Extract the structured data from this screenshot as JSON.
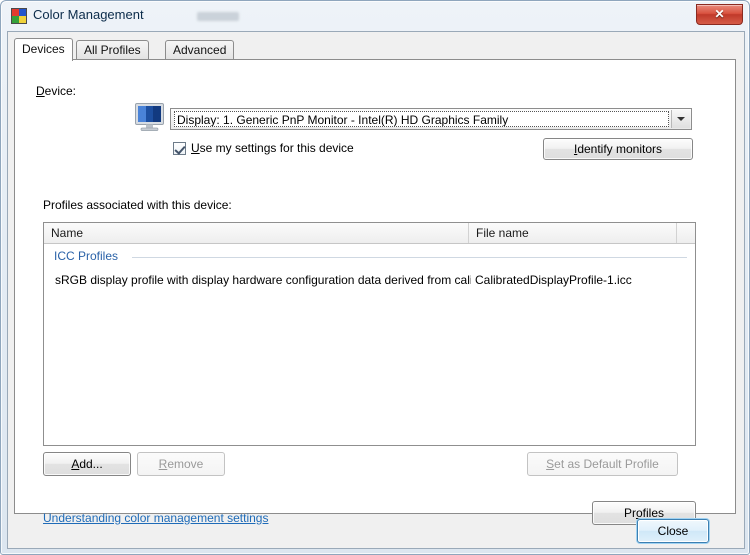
{
  "window": {
    "title": "Color Management",
    "icon": "color-swatch-icon",
    "close_glyph": "✕"
  },
  "tabs": [
    {
      "label": "Devices",
      "active": true
    },
    {
      "label": "All Profiles",
      "active": false
    },
    {
      "label": "Advanced",
      "active": false
    }
  ],
  "device": {
    "label_prefix": "D",
    "label_rest": "evice:",
    "icon": "monitor-icon",
    "combo_value": "Display: 1. Generic PnP Monitor - Intel(R) HD Graphics Family",
    "dropdown_icon": "chevron-down-icon",
    "checkbox": {
      "checked": true,
      "label_prefix": "U",
      "label_rest": "se my settings for this device"
    },
    "identify_button": {
      "prefix": "I",
      "rest": "dentify monitors",
      "enabled": true
    }
  },
  "profiles": {
    "section_label": "Profiles associated with this device:",
    "columns": [
      "Name",
      "File name"
    ],
    "group_header": "ICC Profiles",
    "rows": [
      {
        "name": "sRGB display profile with display hardware configuration data derived from cali...",
        "file": "CalibratedDisplayProfile-1.icc"
      }
    ]
  },
  "actions": {
    "add": {
      "prefix": "A",
      "rest": "dd...",
      "enabled": true
    },
    "remove": {
      "prefix": "R",
      "rest": "emove",
      "enabled": false
    },
    "set_default": {
      "prefix": "S",
      "rest": "et as Default Profile",
      "enabled": false
    },
    "profiles": {
      "before": "Pr",
      "prefix": "o",
      "rest": "files",
      "enabled": true
    }
  },
  "help_link": "Understanding color management settings",
  "footer": {
    "close_label": "Close"
  },
  "colors": {
    "link": "#1e6bb8",
    "group_header": "#2a62a8",
    "title_text": "#0b2b4a",
    "close_red": "#c0392a",
    "focus_blue": "#3c7fb1"
  }
}
